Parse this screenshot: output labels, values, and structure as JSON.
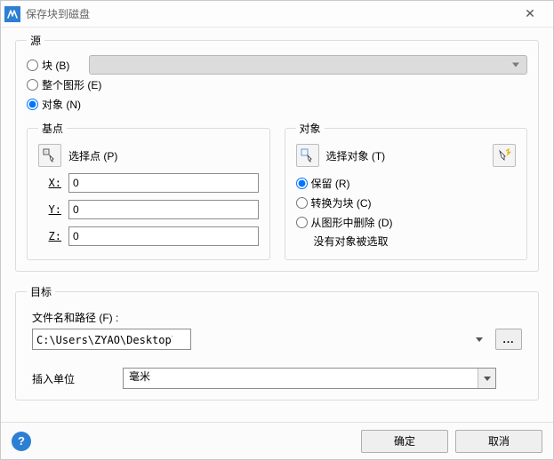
{
  "titlebar": {
    "title": "保存块到磁盘"
  },
  "source": {
    "legend": "源",
    "radio_block": "块 (B)",
    "radio_whole": "整个图形 (E)",
    "radio_object": "对象 (N)"
  },
  "basepoint": {
    "legend": "基点",
    "pick_label": "选择点 (P)",
    "x_label": "X:",
    "y_label": "Y:",
    "z_label": "Z:",
    "x": "0",
    "y": "0",
    "z": "0"
  },
  "objects": {
    "legend": "对象",
    "pick_label": "选择对象 (T)",
    "keep": "保留 (R)",
    "convert": "转换为块 (C)",
    "delete": "从图形中删除 (D)",
    "none_selected": "没有对象被选取"
  },
  "destination": {
    "legend": "目标",
    "path_label": "文件名和路径 (F) :",
    "path": "C:\\Users\\ZYAO\\Desktop\\新块.dwg",
    "browse": "...",
    "unit_label": "插入单位",
    "unit_value": "毫米"
  },
  "footer": {
    "help": "?",
    "ok": "确定",
    "cancel": "取消"
  }
}
